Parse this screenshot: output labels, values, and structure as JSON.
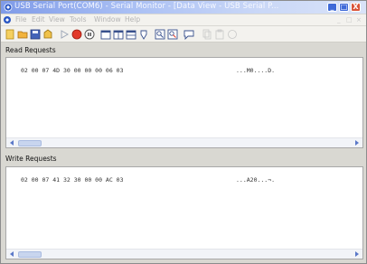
{
  "window": {
    "title": "USB Serial Port(COM6) - Serial Monitor - [Data View - USB Serial P...",
    "controls": {
      "minimize": "_",
      "maximize": "□",
      "close": "X"
    }
  },
  "menu": {
    "items": [
      "File",
      "Edit",
      "View",
      "Tools",
      "Window",
      "Help"
    ]
  },
  "toolbar": {
    "buttons": [
      "new-icon",
      "open-icon",
      "save-icon",
      "session-icon",
      "start-icon",
      "stop-icon",
      "pause-icon",
      "view-icon",
      "view2-icon",
      "view3-icon",
      "settings-icon",
      "find-icon",
      "find-next-icon",
      "comment-icon",
      "copy-icon",
      "paste-icon",
      "help-icon"
    ]
  },
  "read_requests": {
    "label": "Read Requests",
    "hex": "02 00 07 4D 30 00 00 00 06 03",
    "ascii": "...M0....D."
  },
  "write_requests": {
    "label": "Write Requests",
    "hex": "02 00 07 41 32 30 00 00 AC 03",
    "ascii": "...A20...¬."
  },
  "colors": {
    "titlebar_start": "#7f9be8",
    "titlebar_end": "#d9e3f8",
    "close_button": "#d9553b",
    "window_chrome": "#d9d8d2"
  }
}
